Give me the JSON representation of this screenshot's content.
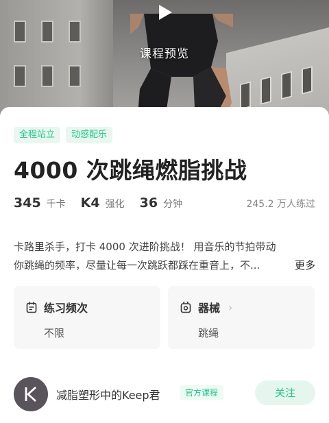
{
  "hero": {
    "preview_label": "课程预览",
    "play_icon": "play-icon"
  },
  "tags": [
    "全程站立",
    "动感配乐"
  ],
  "title": "4000 次跳绳燃脂挑战",
  "stats": {
    "calories": {
      "value": "345",
      "unit": "千卡"
    },
    "level": {
      "value": "K4",
      "unit": "强化"
    },
    "duration": {
      "value": "36",
      "unit": "分钟"
    },
    "trainees": "245.2 万人练过"
  },
  "description": {
    "line1": "卡路里杀手，打卡 4000 次进阶挑战！ 用音乐的节拍带动",
    "line2": "你跳绳的频率，尽量让每一次跳跃都踩在重音上，不...",
    "more_label": "更多"
  },
  "info_boxes": [
    {
      "title": "练习频次",
      "value": "不限",
      "icon": "calendar-icon"
    },
    {
      "title": "器械",
      "value": "跳绳",
      "icon": "equipment-icon"
    }
  ],
  "author": {
    "name": "减脂塑形中的Keep君",
    "badge": "官方课程",
    "follow_label": "关注",
    "avatar_icon": "keep-logo-icon"
  },
  "colors": {
    "accent": "#24c789",
    "tag_bg": "#e8f7ef",
    "box_bg": "#f7f7f7",
    "avatar_bg": "#59535c"
  }
}
